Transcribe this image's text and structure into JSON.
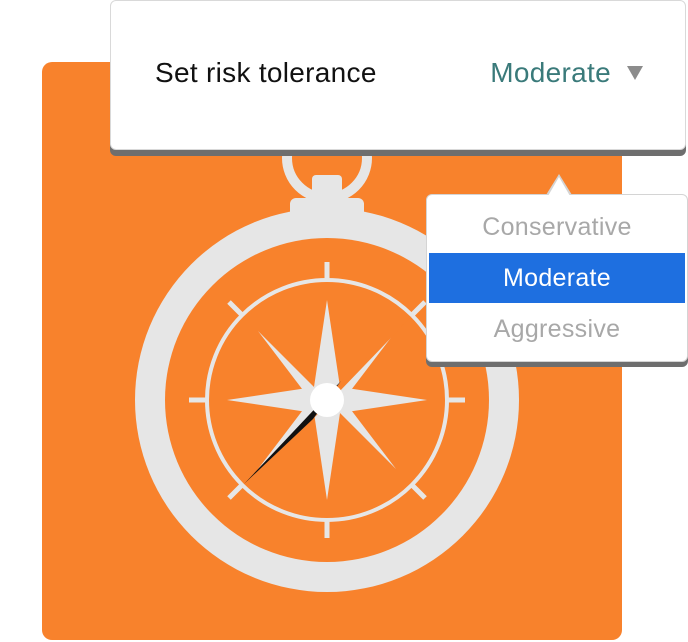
{
  "header": {
    "title": "Set risk tolerance",
    "selected_value": "Moderate"
  },
  "dropdown": {
    "options": [
      {
        "label": "Conservative",
        "selected": false
      },
      {
        "label": "Moderate",
        "selected": true
      },
      {
        "label": "Aggressive",
        "selected": false
      }
    ]
  },
  "icons": {
    "caret": "chevron-down-icon",
    "illustration": "compass-icon"
  },
  "colors": {
    "brand_orange": "#f8822c",
    "selected_value_teal": "#3a7a7a",
    "selected_option_bg": "#1e6fe0",
    "unselected_option_text": "#a8a8a8",
    "compass_body": "#e6e6e6",
    "needle_dark": "#111111"
  }
}
